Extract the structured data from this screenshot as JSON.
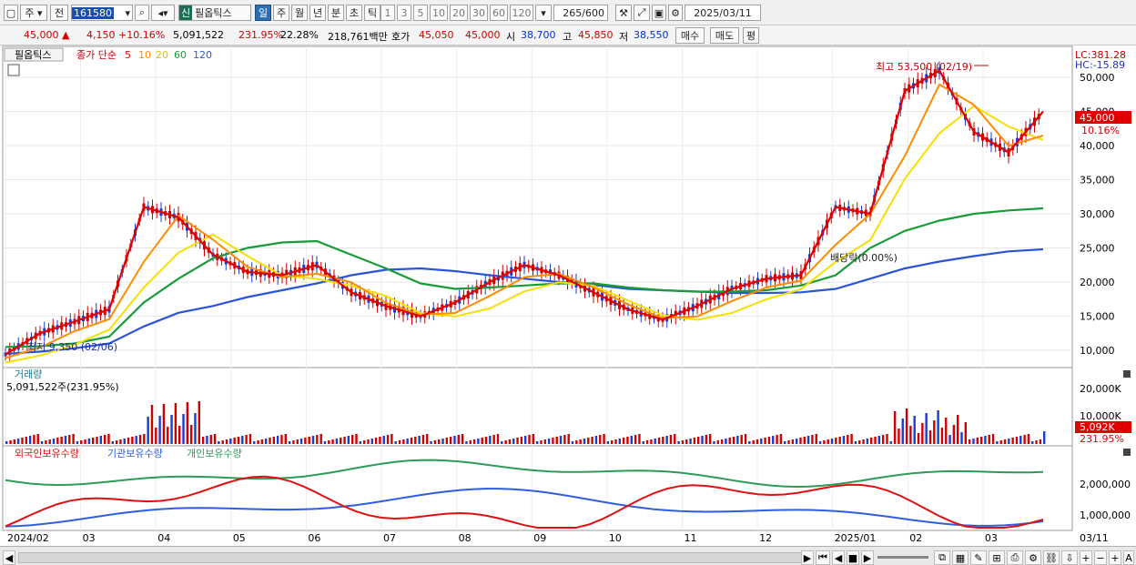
{
  "toolbar": {
    "market": "주",
    "prev": "전",
    "code": "161580",
    "company": "필옵틱스",
    "new_label": "신",
    "periods": [
      "일",
      "주",
      "월",
      "년",
      "분",
      "초",
      "틱"
    ],
    "selected_period": "일",
    "intervals": [
      "1",
      "3",
      "5",
      "10",
      "20",
      "30",
      "60",
      "120"
    ],
    "count": "265",
    "count_total": "/600",
    "date": "2025/03/11"
  },
  "quote": {
    "price": "45,000",
    "change": "4,150",
    "change_pct": "+10.16%",
    "volume": "5,091,522",
    "volume_ratio": "231.95%",
    "turnover": "22.28%",
    "amount": "218,761백만",
    "bid_label": "호가",
    "bid": "45,050",
    "ask": "45,000",
    "open_label": "시",
    "open": "38,700",
    "high_label": "고",
    "high": "45,850",
    "low_label": "저",
    "low": "38,550",
    "buy": "매수",
    "sell": "매도",
    "avg": "평"
  },
  "main_panel": {
    "name_tab": "필옵틱스",
    "legend_prefix": "종가 단순",
    "ma_periods": [
      "5",
      "10",
      "20",
      "60",
      "120"
    ],
    "lc": "LC:381.28",
    "hc": "HC:-15.89",
    "high_note": "최고 53,500 (02/19)",
    "low_note": "최저 9,350 (02/06)",
    "div_note": "배당락(0.00%)",
    "price_tag": "45,000",
    "pct_tag": "10.16%",
    "y_labels": [
      "50,000",
      "45,000",
      "40,000",
      "35,000",
      "30,000",
      "25,000",
      "20,000",
      "15,000",
      "10,000"
    ]
  },
  "volume_panel": {
    "title": "거래량",
    "value": "5,091,522주(231.95%)",
    "y_labels": [
      "20,000K",
      "10,000K"
    ],
    "tag": "5,092K",
    "tag_pct": "231.95%"
  },
  "holding_panel": {
    "series": [
      "외국인보유수량",
      "기관보유수량",
      "개인보유수량"
    ],
    "y_labels": [
      "2,000,000",
      "1,000,000"
    ]
  },
  "x_axis": [
    "2024/02",
    "03",
    "04",
    "05",
    "06",
    "07",
    "08",
    "09",
    "10",
    "11",
    "12",
    "2025/01",
    "02",
    "03"
  ],
  "x_last": "03/11",
  "colors": {
    "ma5": "#e00000",
    "ma10": "#ff8c00",
    "ma20": "#f5e000",
    "ma60": "#1a9b3a",
    "ma120": "#2b55d9",
    "up": "#d00000",
    "down": "#1a3ccf",
    "foreign": "#e01010",
    "institution": "#2f5ee0",
    "individual": "#2e9a5a"
  },
  "chart_data": {
    "type": "line",
    "price_index": [
      9.4,
      12.5,
      14.2,
      16.0,
      31.0,
      29.5,
      24.0,
      21.5,
      21.0,
      22.5,
      18.5,
      16.5,
      15.0,
      17.0,
      20.0,
      22.5,
      21.0,
      18.5,
      16.0,
      14.5,
      16.5,
      19.0,
      20.5,
      21.0,
      31.0,
      30.0,
      48.0,
      51.0,
      42.0,
      39.0,
      45.0
    ],
    "ma5": [
      9.4,
      12.5,
      14.2,
      16.0,
      31.0,
      29.5,
      24.0,
      21.5,
      21.0,
      22.5,
      18.5,
      16.5,
      15.0,
      17.0,
      20.0,
      22.5,
      21.0,
      18.5,
      16.0,
      14.5,
      16.5,
      19.0,
      20.5,
      21.0,
      31.0,
      30.0,
      48.0,
      51.0,
      42.0,
      39.0,
      45.0
    ],
    "ma60": [
      10.5,
      10.6,
      11.0,
      12.0,
      17.0,
      20.5,
      23.5,
      25.0,
      25.8,
      26.0,
      24.0,
      22.0,
      19.8,
      19.0,
      19.2,
      19.5,
      19.8,
      19.8,
      19.2,
      18.8,
      18.6,
      18.6,
      18.8,
      19.5,
      21.0,
      25.0,
      27.5,
      29.0,
      30.0,
      30.5,
      30.8
    ],
    "ma120": [
      9.5,
      9.8,
      10.3,
      11.0,
      13.5,
      15.5,
      16.5,
      17.8,
      18.8,
      19.8,
      21.0,
      21.8,
      22.0,
      21.6,
      21.0,
      20.5,
      20.0,
      19.6,
      19.0,
      18.8,
      18.6,
      18.4,
      18.4,
      18.5,
      19.0,
      20.5,
      22.0,
      23.0,
      23.8,
      24.5,
      24.8
    ],
    "ylim": [
      8000,
      54000
    ]
  }
}
